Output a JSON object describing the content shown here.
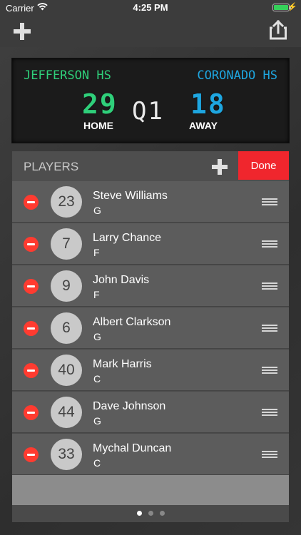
{
  "status_bar": {
    "carrier": "Carrier",
    "time": "4:25 PM"
  },
  "scoreboard": {
    "home_team": "JEFFERSON HS",
    "away_team": "CORONADO HS",
    "home_score": "29",
    "away_score": "18",
    "period": "Q1",
    "home_label": "HOME",
    "away_label": "AWAY",
    "home_color": "#2fcf7a",
    "away_color": "#1ea6e0"
  },
  "players_panel": {
    "title": "PLAYERS",
    "done_label": "Done",
    "players": [
      {
        "number": "23",
        "name": "Steve Williams",
        "position": "G"
      },
      {
        "number": "7",
        "name": "Larry Chance",
        "position": "F"
      },
      {
        "number": "9",
        "name": "John Davis",
        "position": "F"
      },
      {
        "number": "6",
        "name": "Albert Clarkson",
        "position": "G"
      },
      {
        "number": "40",
        "name": "Mark Harris",
        "position": "C"
      },
      {
        "number": "44",
        "name": "Dave Johnson",
        "position": "G"
      },
      {
        "number": "33",
        "name": "Mychal Duncan",
        "position": "C"
      }
    ]
  },
  "pager": {
    "pages": 3,
    "current": 1
  },
  "icons": {
    "nav_left": "plus-icon",
    "nav_right": "share-icon",
    "row_delete": "minus-circle-icon",
    "row_reorder": "drag-handle-icon"
  }
}
